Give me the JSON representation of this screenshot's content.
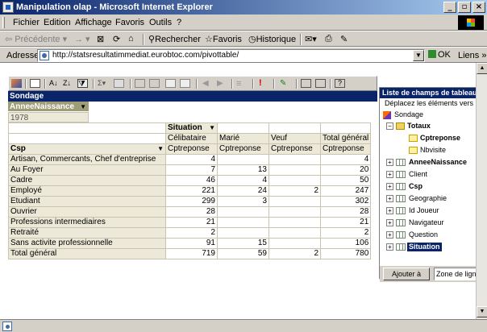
{
  "window": {
    "title": "Manipulation olap - Microsoft Internet Explorer"
  },
  "menu": [
    "Fichier",
    "Edition",
    "Affichage",
    "Favoris",
    "Outils",
    "?"
  ],
  "toolbar": {
    "back": "Précédente",
    "forward": "→",
    "search": "Rechercher",
    "favorites": "Favoris",
    "history": "Historique"
  },
  "address": {
    "label": "Adresse",
    "url": "http://statsresultatimmediat.eurobtoc.com/pivottable/",
    "go": "OK",
    "links": "Liens"
  },
  "pivot": {
    "title": "Sondage",
    "page_field": "AnneeNaissance",
    "page_value": "1978",
    "column_field": "Situation",
    "row_field": "Csp",
    "columns": [
      "Célibataire",
      "Marié",
      "Veuf",
      "Total général"
    ],
    "measure": "Cptreponse",
    "rows": [
      {
        "label": "Artisan, Commercants, Chef d'entreprise",
        "values": [
          "4",
          "",
          "",
          "4"
        ]
      },
      {
        "label": "Au Foyer",
        "values": [
          "7",
          "13",
          "",
          "20"
        ]
      },
      {
        "label": "Cadre",
        "values": [
          "46",
          "4",
          "",
          "50"
        ]
      },
      {
        "label": "Employé",
        "values": [
          "221",
          "24",
          "2",
          "247"
        ]
      },
      {
        "label": "Etudiant",
        "values": [
          "299",
          "3",
          "",
          "302"
        ]
      },
      {
        "label": "Ouvrier",
        "values": [
          "28",
          "",
          "",
          "28"
        ]
      },
      {
        "label": "Professions intermediaires",
        "values": [
          "21",
          "",
          "",
          "21"
        ]
      },
      {
        "label": "Retraité",
        "values": [
          "2",
          "",
          "",
          "2"
        ]
      },
      {
        "label": "Sans activite professionnelle",
        "values": [
          "91",
          "15",
          "",
          "106"
        ]
      }
    ],
    "total": {
      "label": "Total général",
      "values": [
        "719",
        "59",
        "2",
        "780"
      ]
    }
  },
  "fieldlist": {
    "title": "Liste de champs de tableau...",
    "description": "Déplacez les éléments vers la liste",
    "root": "Sondage",
    "totals": "Totaux",
    "measures": [
      "Cptreponse",
      "Nbvisite"
    ],
    "fields": [
      "AnneeNaissance",
      "Client",
      "Csp",
      "Geographie",
      "Id Joueur",
      "Navigateur",
      "Question",
      "Situation"
    ],
    "add_button": "Ajouter à",
    "zone": "Zone de lignes"
  }
}
